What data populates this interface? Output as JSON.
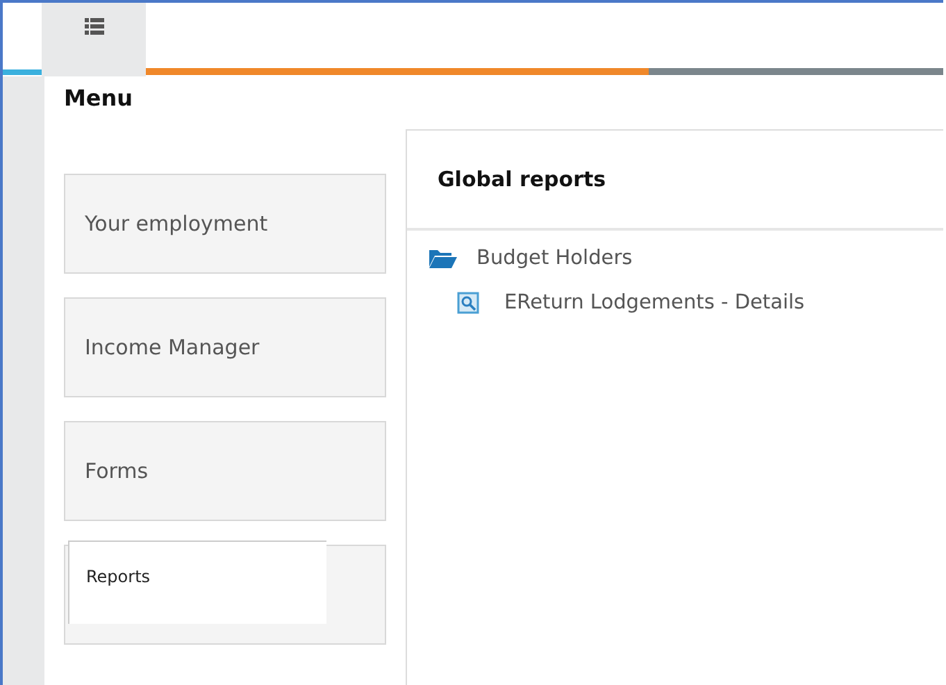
{
  "top_bar": {
    "tabs": [
      {
        "kind": "list",
        "selected": true
      }
    ],
    "progress": {
      "level": 0.63
    }
  },
  "menu": {
    "title": "Menu",
    "items": [
      {
        "label": "Your employment",
        "selected": false
      },
      {
        "label": "Income Manager",
        "selected": false
      },
      {
        "label": "Forms",
        "selected": false
      },
      {
        "label": "Reports",
        "selected": true
      }
    ]
  },
  "reports_panel": {
    "title": "Global reports",
    "tree": [
      {
        "kind": "folder",
        "label": "Budget Holders",
        "children": [
          {
            "kind": "report",
            "label": "EReturn Lodgements - Details"
          }
        ]
      }
    ]
  }
}
